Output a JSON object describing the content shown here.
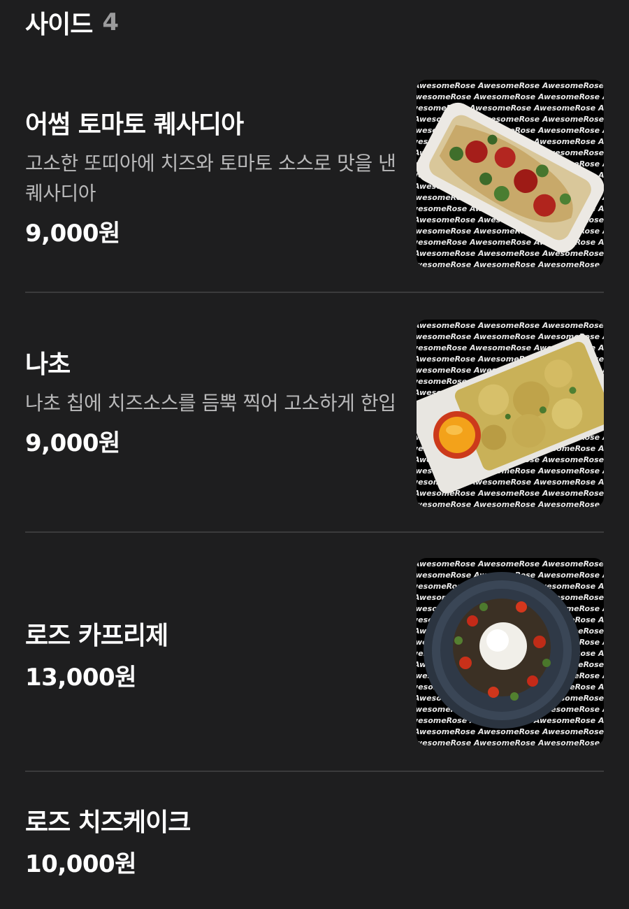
{
  "section": {
    "title": "사이드",
    "count": "4"
  },
  "watermark": "AwesomeRose",
  "items": [
    {
      "name": "어썸 토마토 퀘사디아",
      "description": "고소한 또띠아에 치즈와 토마토 소스로 맛을 낸 퀘사디아",
      "price": "9,000원",
      "photo_icon": "quesadilla-photo"
    },
    {
      "name": "나초",
      "description": "나초 칩에 치즈소스를 듬뿍 찍어 고소하게 한입",
      "price": "9,000원",
      "photo_icon": "nachos-photo"
    },
    {
      "name": "로즈 카프리제",
      "description": "",
      "price": "13,000원",
      "photo_icon": "caprese-photo"
    },
    {
      "name": "로즈 치즈케이크",
      "description": "",
      "price": "10,000원",
      "photo_icon": ""
    }
  ],
  "colors": {
    "background": "#1e1e1f",
    "text_primary": "#ffffff",
    "text_secondary": "#b9b9ba",
    "count": "#9b9b9c",
    "divider": "#3b3b3c"
  }
}
